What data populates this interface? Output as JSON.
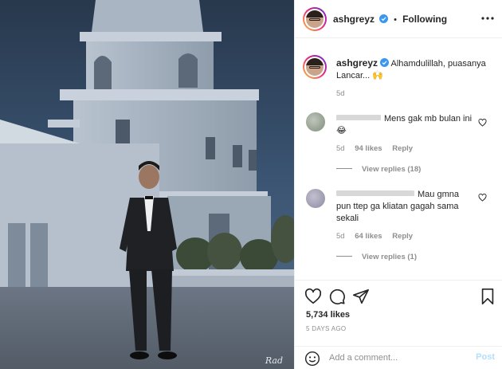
{
  "header": {
    "username": "ashgreyz",
    "follow_state": "Following",
    "dot": "•"
  },
  "caption": {
    "username": "ashgreyz",
    "text": "Alhamdulillah, puasanya Lancar... 🙌",
    "age": "5d"
  },
  "comments": [
    {
      "text": "Mens gak mb bulan ini 😂",
      "age": "5d",
      "likes": "94 likes",
      "reply_label": "Reply",
      "view_replies": "View replies (18)"
    },
    {
      "text": "Mau gmna pun ttep ga kliatan gagah sama sekali",
      "age": "5d",
      "likes": "64 likes",
      "reply_label": "Reply",
      "view_replies": "View replies (1)"
    }
  ],
  "actions": {
    "likes": "5,734 likes",
    "posted": "5 DAYS AGO"
  },
  "add_comment": {
    "placeholder": "Add a comment...",
    "post_label": "Post"
  },
  "photo": {
    "signature": "Rad"
  },
  "colors": {
    "verified": "#3897f0",
    "post_disabled": "#b2dffc",
    "secondary_text": "#8e8e8e"
  },
  "icons": [
    "heart-icon",
    "comment-icon",
    "share-icon",
    "bookmark-icon",
    "verified-icon",
    "more-icon",
    "emoji-icon"
  ]
}
